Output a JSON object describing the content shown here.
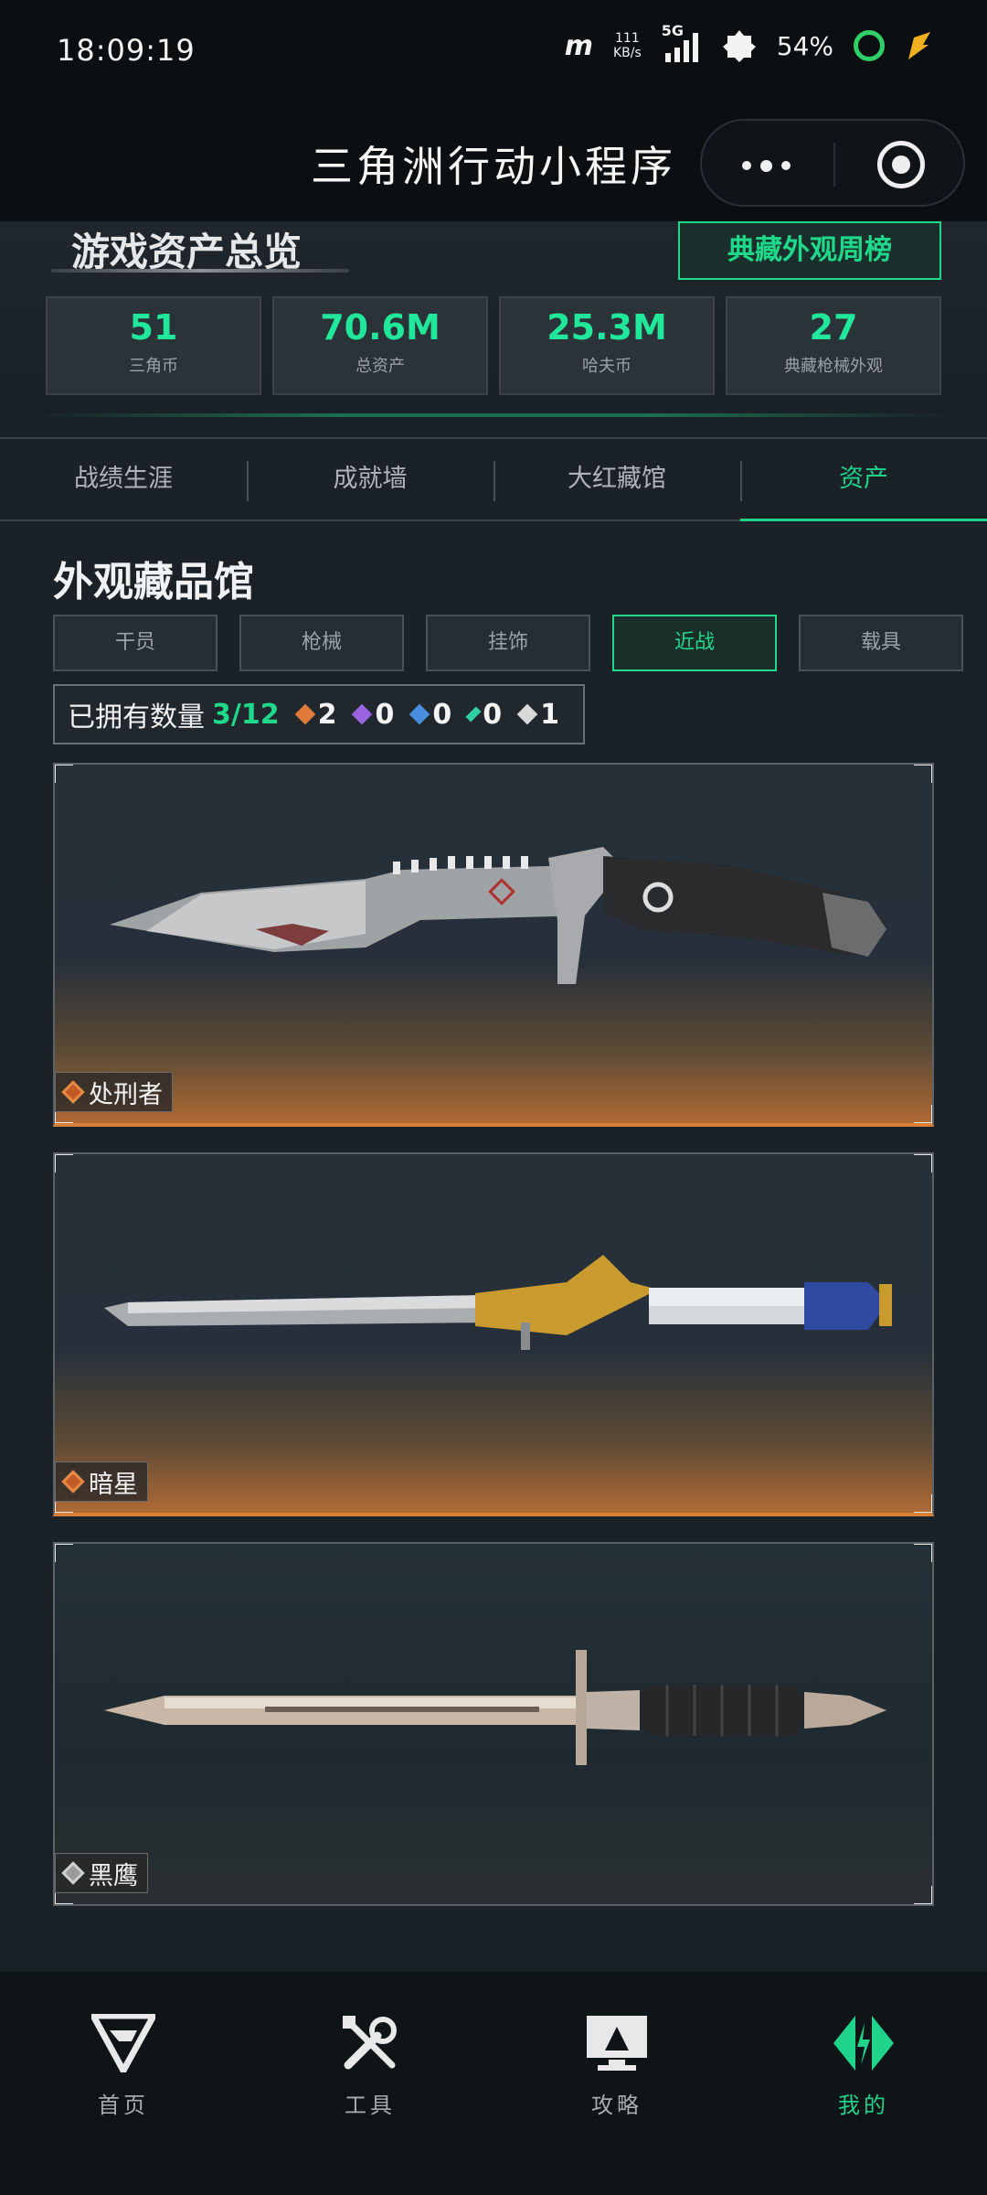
{
  "status_bar": {
    "time": "18:09:19",
    "speed_top": "111",
    "speed_unit": "KB/s",
    "network": "5G",
    "battery": "54%"
  },
  "titlebar": {
    "title": "三角洲行动小程序"
  },
  "overview": {
    "title": "游戏资产总览",
    "weekly_button": "典藏外观周榜",
    "stats": [
      {
        "value": "51",
        "label": "三角币"
      },
      {
        "value": "70.6M",
        "label": "总资产"
      },
      {
        "value": "25.3M",
        "label": "哈夫币"
      },
      {
        "value": "27",
        "label": "典藏枪械外观"
      }
    ]
  },
  "tabs": [
    {
      "label": "战绩生涯"
    },
    {
      "label": "成就墙"
    },
    {
      "label": "大红藏馆"
    },
    {
      "label": "资产"
    }
  ],
  "collection": {
    "title": "外观藏品馆",
    "categories": [
      "干员",
      "枪械",
      "挂饰",
      "近战",
      "载具"
    ],
    "owned_label": "已拥有数量",
    "owned_count": "3/12",
    "rarity_counts": [
      "2",
      "0",
      "0",
      "0",
      "1"
    ],
    "rarity_colors": [
      "#e07a3a",
      "#9a63e0",
      "#4a8ee0",
      "#2fd0a0",
      "#d8d8d8"
    ]
  },
  "items": [
    {
      "name": "处刑者",
      "rarity": "gold"
    },
    {
      "name": "暗星",
      "rarity": "gold"
    },
    {
      "name": "黑鹰",
      "rarity": "white"
    }
  ],
  "bottom_nav": [
    {
      "label": "首页",
      "icon": "home-logo-icon"
    },
    {
      "label": "工具",
      "icon": "tools-icon"
    },
    {
      "label": "攻略",
      "icon": "guide-monitor-icon"
    },
    {
      "label": "我的",
      "icon": "profile-logo-icon"
    }
  ],
  "accent_color": "#1ed98a"
}
